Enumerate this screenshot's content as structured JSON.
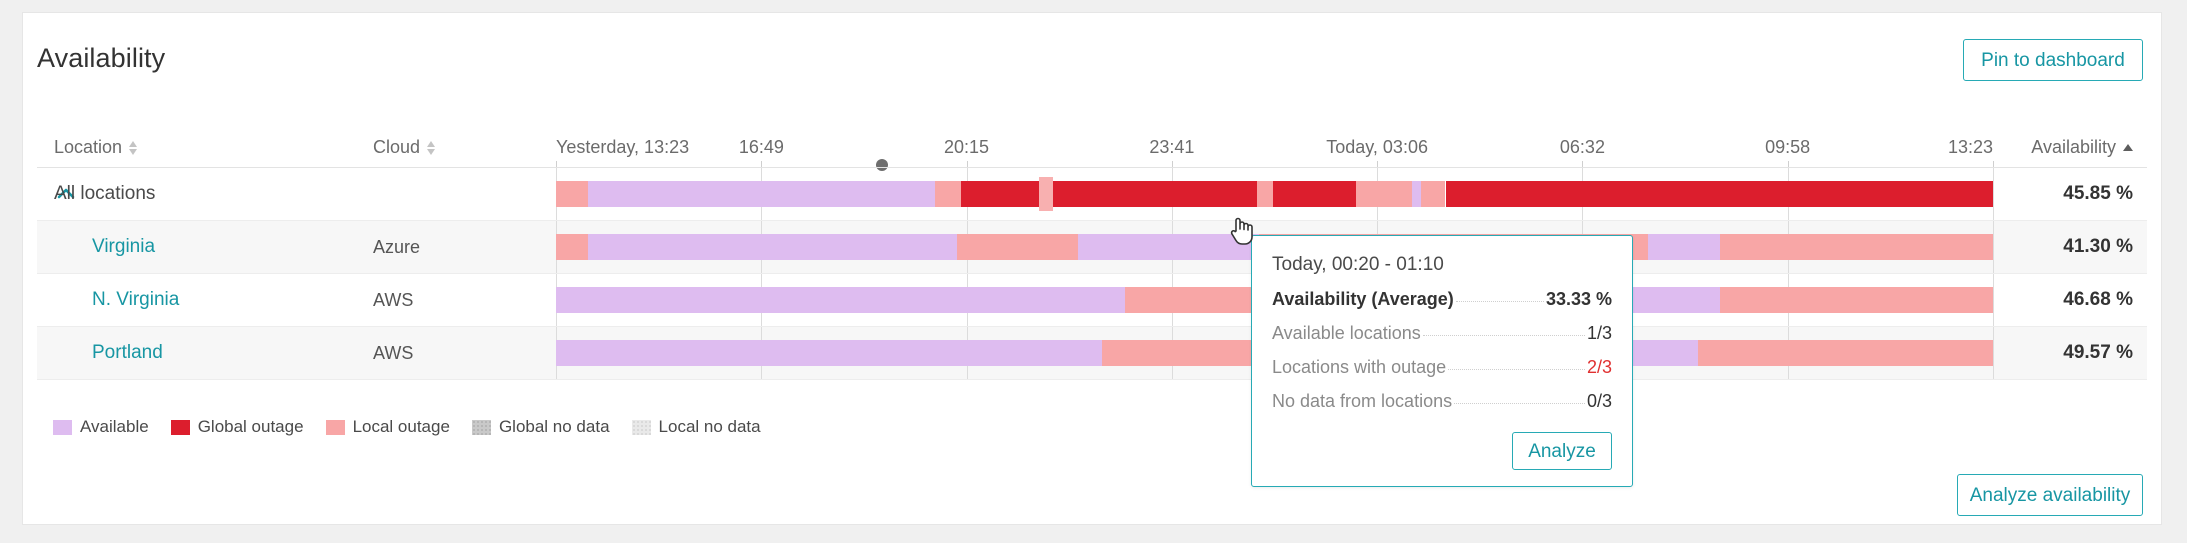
{
  "header": {
    "title": "Availability",
    "pin_label": "Pin to dashboard"
  },
  "footer": {
    "analyze_availability_label": "Analyze availability"
  },
  "columns": {
    "location": "Location",
    "cloud": "Cloud",
    "availability": "Availability"
  },
  "time_axis": {
    "ticks": [
      {
        "label": "Yesterday, 13:23",
        "pos": 0.0
      },
      {
        "label": "16:49",
        "pos": 0.1429
      },
      {
        "label": "20:15",
        "pos": 0.2857
      },
      {
        "label": "23:41",
        "pos": 0.4286
      },
      {
        "label": "Today, 03:06",
        "pos": 0.5714
      },
      {
        "label": "06:32",
        "pos": 0.7143
      },
      {
        "label": "09:58",
        "pos": 0.8571
      },
      {
        "label": "13:23",
        "pos": 1.0
      }
    ],
    "hover_marker_pos": 0.2267
  },
  "rows": [
    {
      "name": "All locations",
      "cloud": "",
      "availability": "45.85 %",
      "expanded": true,
      "is_parent": true,
      "segments": [
        {
          "start": 0.0,
          "end": 0.022,
          "state": "local-outage"
        },
        {
          "start": 0.022,
          "end": 0.264,
          "state": "available"
        },
        {
          "start": 0.264,
          "end": 0.282,
          "state": "local-outage"
        },
        {
          "start": 0.282,
          "end": 0.336,
          "state": "global-outage"
        },
        {
          "start": 0.336,
          "end": 0.346,
          "state": "local-outage"
        },
        {
          "start": 0.346,
          "end": 0.488,
          "state": "global-outage"
        },
        {
          "start": 0.488,
          "end": 0.499,
          "state": "local-outage"
        },
        {
          "start": 0.499,
          "end": 0.557,
          "state": "global-outage"
        },
        {
          "start": 0.557,
          "end": 0.596,
          "state": "local-outage"
        },
        {
          "start": 0.596,
          "end": 0.602,
          "state": "available"
        },
        {
          "start": 0.602,
          "end": 0.619,
          "state": "local-outage"
        },
        {
          "start": 0.619,
          "end": 1.0,
          "state": "global-outage"
        }
      ]
    },
    {
      "name": "Virginia",
      "cloud": "Azure",
      "availability": "41.30 %",
      "expanded": false,
      "is_parent": false,
      "segments": [
        {
          "start": 0.0,
          "end": 0.022,
          "state": "local-outage"
        },
        {
          "start": 0.022,
          "end": 0.279,
          "state": "available"
        },
        {
          "start": 0.279,
          "end": 0.363,
          "state": "local-outage"
        },
        {
          "start": 0.363,
          "end": 0.489,
          "state": "available"
        },
        {
          "start": 0.489,
          "end": 0.76,
          "state": "local-outage"
        },
        {
          "start": 0.76,
          "end": 0.81,
          "state": "available"
        },
        {
          "start": 0.81,
          "end": 1.0,
          "state": "local-outage"
        }
      ]
    },
    {
      "name": "N. Virginia",
      "cloud": "AWS",
      "availability": "46.68 %",
      "expanded": false,
      "is_parent": false,
      "segments": [
        {
          "start": 0.0,
          "end": 0.396,
          "state": "available"
        },
        {
          "start": 0.396,
          "end": 0.495,
          "state": "local-outage"
        },
        {
          "start": 0.495,
          "end": 0.75,
          "state": "available"
        },
        {
          "start": 0.75,
          "end": 0.81,
          "state": "available"
        },
        {
          "start": 0.81,
          "end": 1.0,
          "state": "local-outage"
        }
      ]
    },
    {
      "name": "Portland",
      "cloud": "AWS",
      "availability": "49.57 %",
      "expanded": false,
      "is_parent": false,
      "segments": [
        {
          "start": 0.0,
          "end": 0.38,
          "state": "available"
        },
        {
          "start": 0.38,
          "end": 0.495,
          "state": "local-outage"
        },
        {
          "start": 0.495,
          "end": 0.52,
          "state": "available"
        },
        {
          "start": 0.52,
          "end": 0.76,
          "state": "available"
        },
        {
          "start": 0.76,
          "end": 0.795,
          "state": "available"
        },
        {
          "start": 0.795,
          "end": 1.0,
          "state": "local-outage"
        }
      ]
    }
  ],
  "legend": [
    {
      "label": "Available",
      "state": "available"
    },
    {
      "label": "Global outage",
      "state": "global-outage"
    },
    {
      "label": "Local outage",
      "state": "local-outage"
    },
    {
      "label": "Global no data",
      "state": "global-no-data"
    },
    {
      "label": "Local no data",
      "state": "local-no-data"
    }
  ],
  "tooltip": {
    "title": "Today, 00:20 - 01:10",
    "rows": [
      {
        "key": "Availability (Average)",
        "value": "33.33 %",
        "strong": true,
        "danger": false
      },
      {
        "key": "Available locations",
        "value": "1/3",
        "strong": false,
        "danger": false
      },
      {
        "key": "Locations with outage",
        "value": "2/3",
        "strong": false,
        "danger": true
      },
      {
        "key": "No data from locations",
        "value": "0/3",
        "strong": false,
        "danger": false
      }
    ],
    "analyze_label": "Analyze"
  },
  "colors": {
    "available": "#DEBCF0",
    "global-outage": "#DC1E2D",
    "local-outage": "#F8A6A6",
    "global-no-data": "#C9C9C9",
    "local-no-data": "#E9E9E9",
    "accent": "#27AAB5",
    "danger_text": "#E03030"
  },
  "hovered_segment": {
    "row": 0,
    "start": 0.336,
    "end": 0.346
  }
}
